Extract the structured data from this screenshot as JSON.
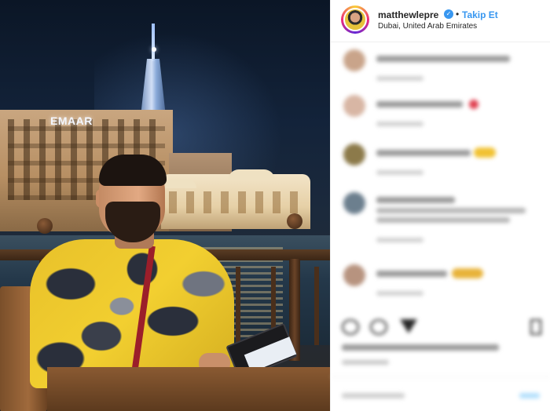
{
  "post": {
    "username": "matthewlepre",
    "verified_mark": "✓",
    "separator": "•",
    "follow_label": "Takip Et",
    "location": "Dubai, United Arab Emirates"
  },
  "photo": {
    "sign_text": "EMAAR"
  },
  "colors": {
    "accent": "#3897f0",
    "text": "#262626",
    "muted": "#8e8e8e"
  },
  "icons": [
    "heart-icon",
    "comment-icon",
    "share-icon",
    "bookmark-icon"
  ]
}
